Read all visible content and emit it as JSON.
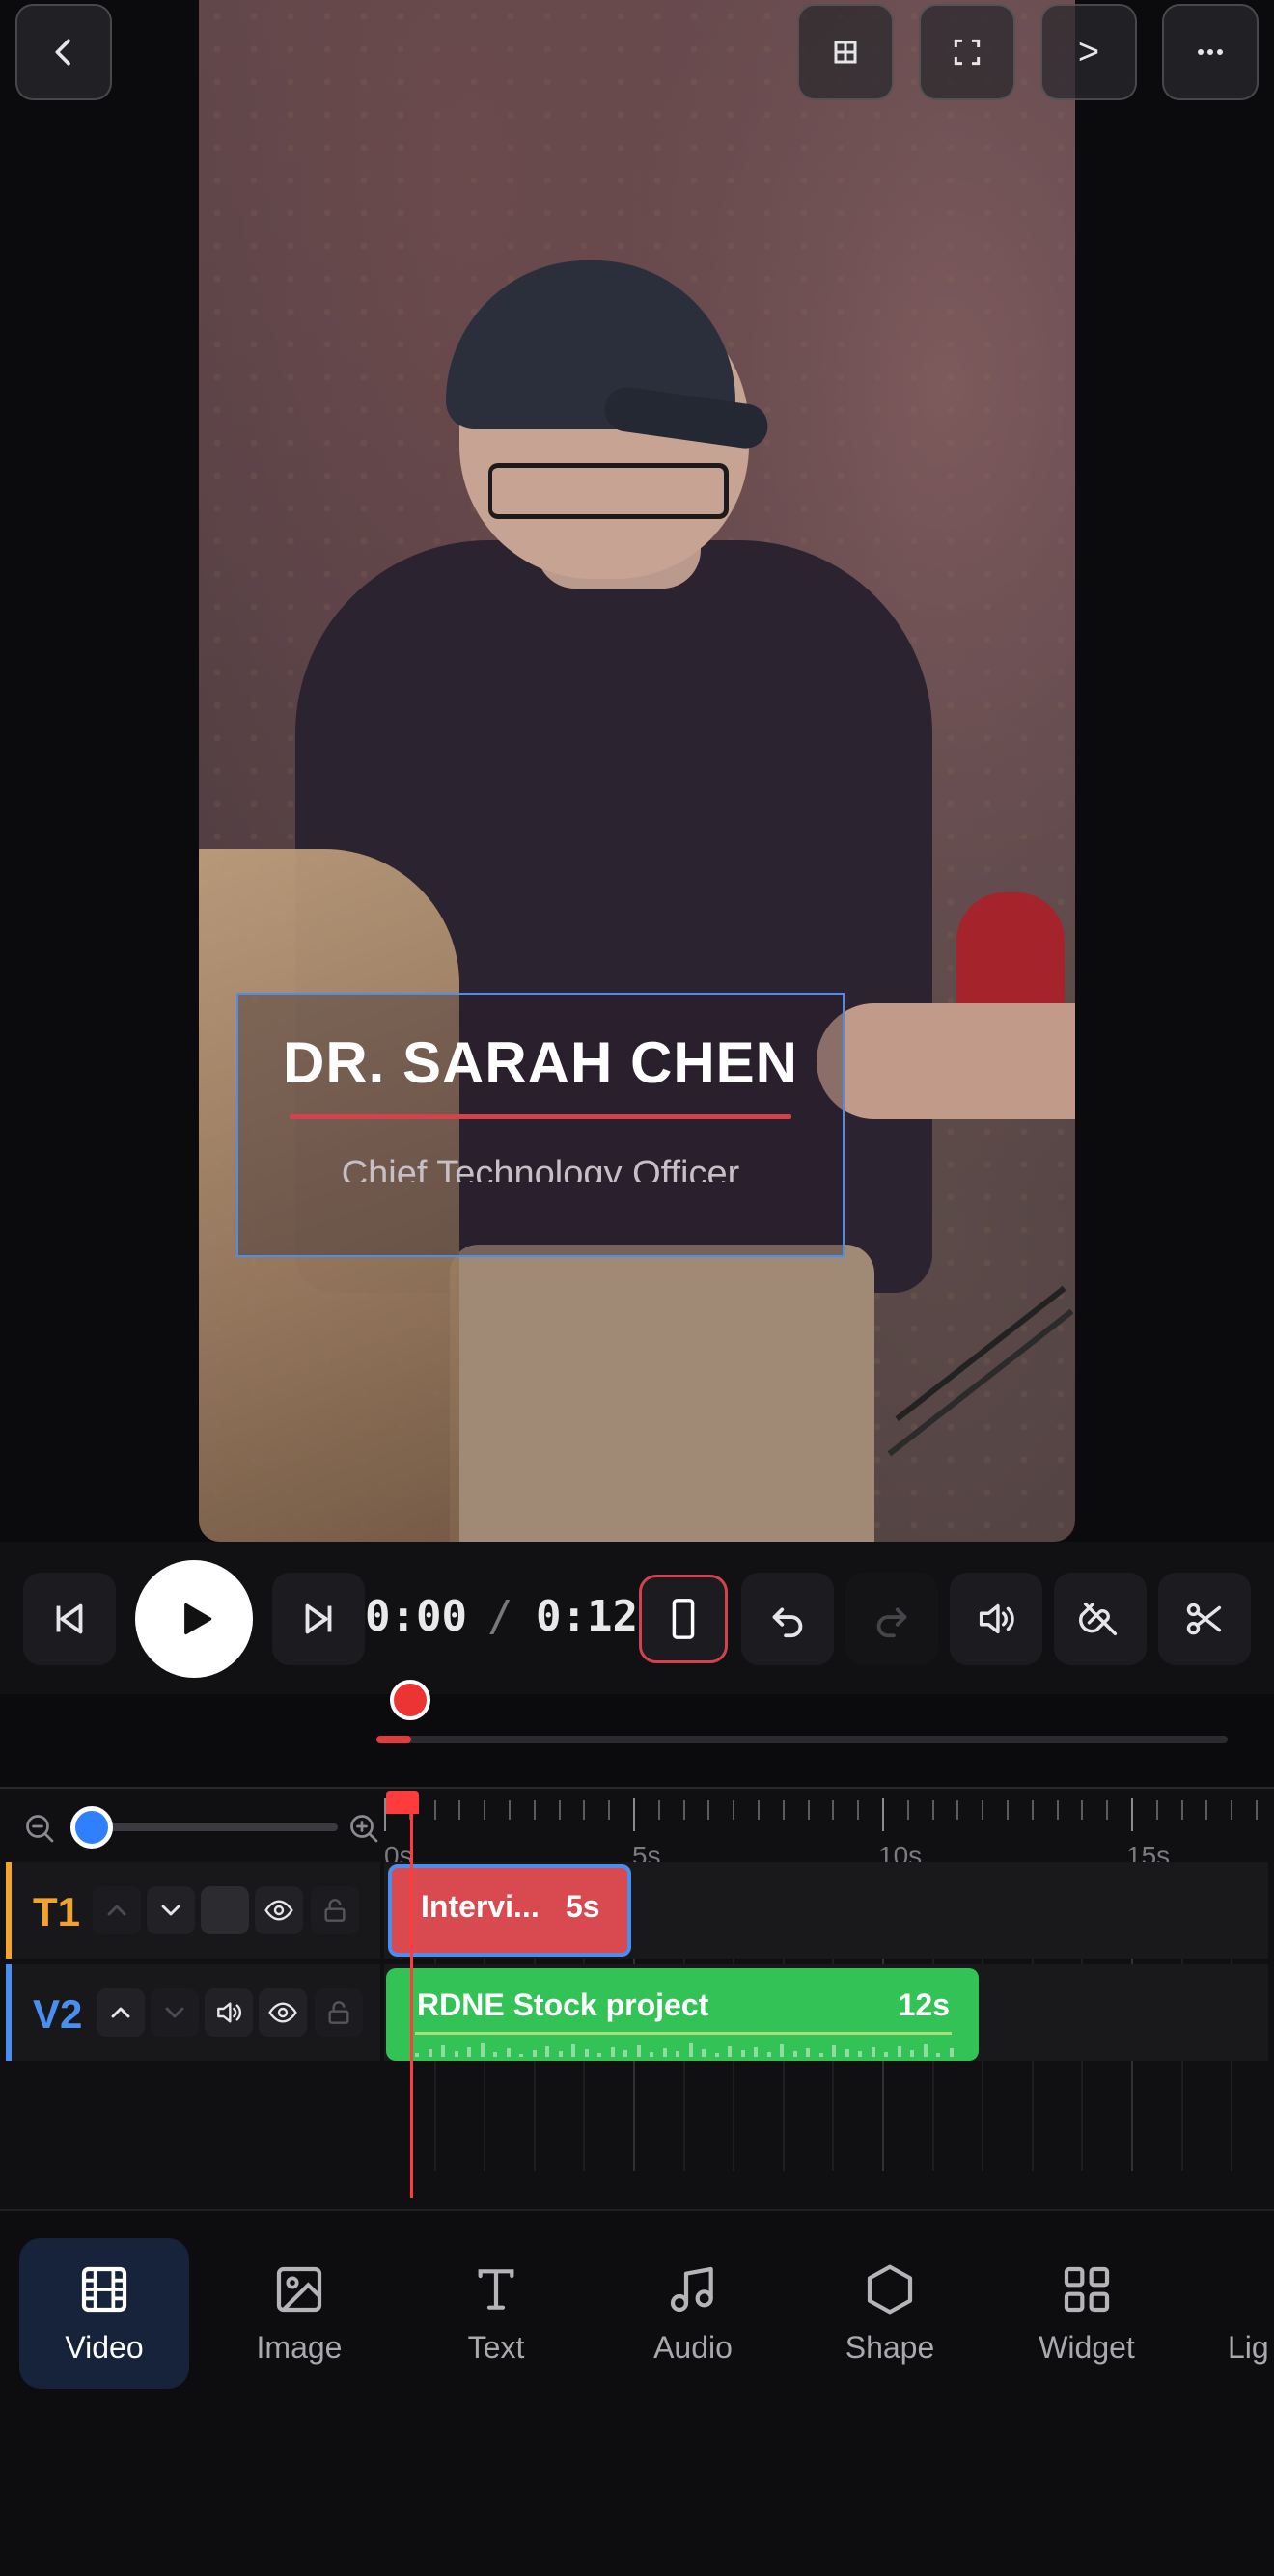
{
  "overlay": {
    "name": "DR. SARAH CHEN",
    "role": "Chief Technology Officer"
  },
  "top_bar": {
    "more_label": "...",
    "next_label": ">"
  },
  "transport": {
    "current_time": "0:00",
    "separator": "/",
    "total_time": "0:12"
  },
  "ruler": {
    "labels": [
      "0s",
      "5s",
      "10s",
      "15s"
    ]
  },
  "tracks": [
    {
      "id": "T1",
      "color": "#f3a32d"
    },
    {
      "id": "V2",
      "color": "#4a8ef0"
    }
  ],
  "clips": {
    "text_clip": {
      "label": "Intervi...",
      "duration": "5s"
    },
    "video_clip": {
      "label": "RDNE Stock project",
      "duration": "12s"
    }
  },
  "zoom": {
    "level": 0.05
  },
  "nav": {
    "items": [
      {
        "label": "Video",
        "icon": "film-icon"
      },
      {
        "label": "Image",
        "icon": "image-icon"
      },
      {
        "label": "Text",
        "icon": "text-icon"
      },
      {
        "label": "Audio",
        "icon": "music-icon"
      },
      {
        "label": "Shape",
        "icon": "hexagon-icon"
      },
      {
        "label": "Widget",
        "icon": "grid-icon"
      },
      {
        "label": "Lig",
        "icon": ""
      }
    ],
    "active_index": 0
  },
  "colors": {
    "accent_blue": "#4a8ef0",
    "playhead_red": "#ff3b3b",
    "text_clip": "#d94a50",
    "video_clip": "#33c255",
    "t1_label": "#f3a32d",
    "v2_label": "#4a8ef0"
  }
}
